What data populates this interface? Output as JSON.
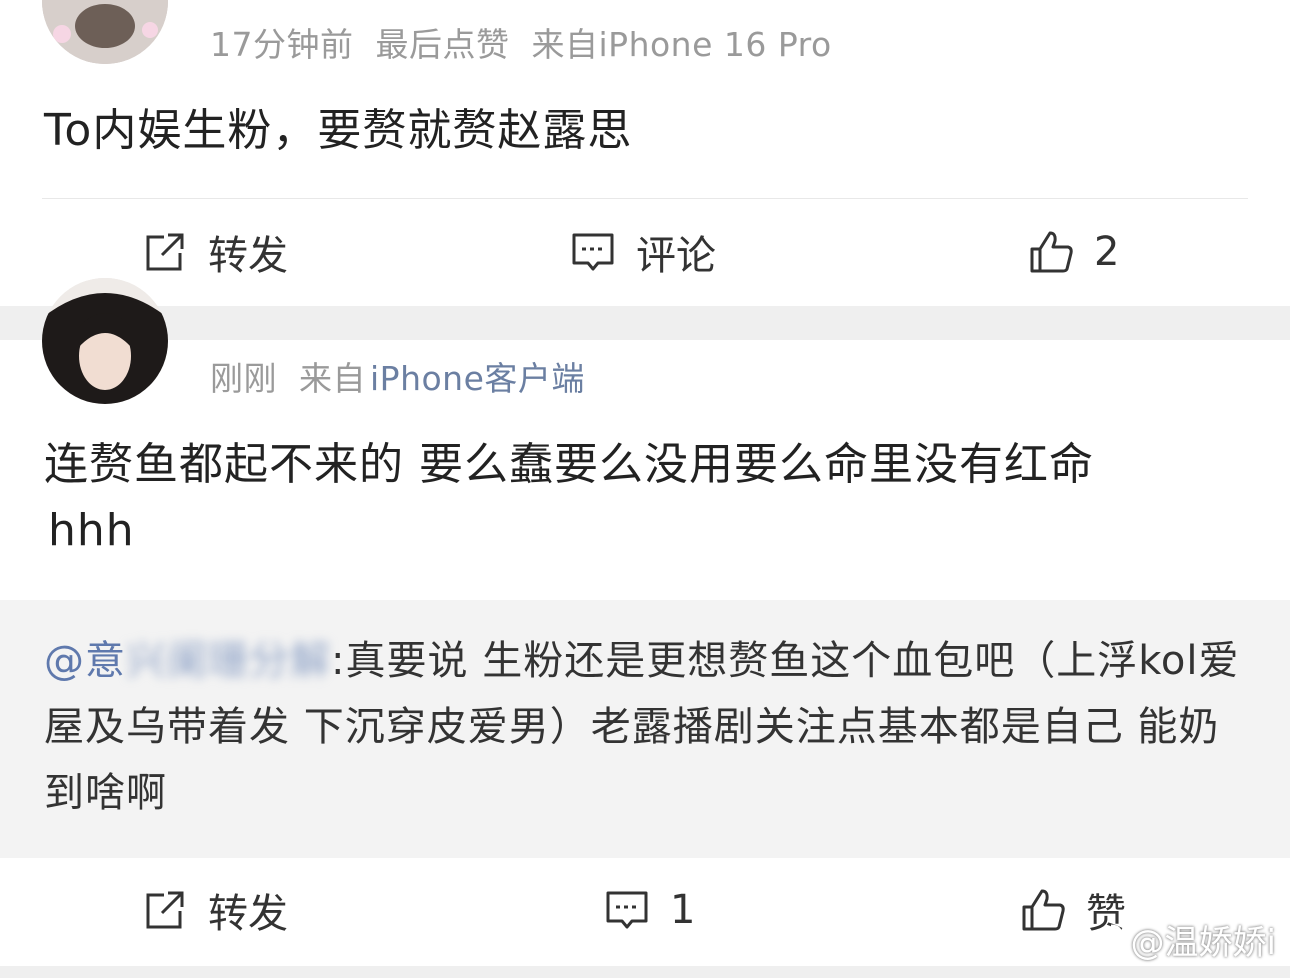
{
  "post1": {
    "meta": {
      "time": "17分钟前",
      "liked": "最后点赞",
      "source": "来自iPhone 16 Pro"
    },
    "text": "To内娱生粉，要赘就赘赵露思",
    "actions": {
      "repost_label": "转发",
      "comment_label": "评论",
      "like_count": "2"
    }
  },
  "post2": {
    "meta": {
      "time": "刚刚",
      "source_prefix": "来自",
      "source_device": "iPhone客户端"
    },
    "text_line1": "连赘鱼都起不来的 要么蠢要么没用要么命里没有红命",
    "text_line2": "hhh",
    "quote": {
      "mention": "@意",
      "mention_blurred": "兴阑珊分解",
      "content": ":真要说 生粉还是更想赘鱼这个血包吧（上浮kol爱屋及乌带着发 下沉穿皮爱男）老露播剧关注点基本都是自己 能奶到啥啊"
    },
    "actions": {
      "repost_label": "转发",
      "comment_count": "1",
      "like_label": "赞"
    }
  },
  "watermark": {
    "text": "@温娇娇i"
  },
  "icons": [
    "repost-icon",
    "comment-icon",
    "like-icon",
    "weibo-logo-icon"
  ],
  "colors": {
    "meta_gray": "#9a9a9a",
    "link_blue": "#5f79ad",
    "quote_bg": "#f3f3f3",
    "separator": "#efefef"
  }
}
